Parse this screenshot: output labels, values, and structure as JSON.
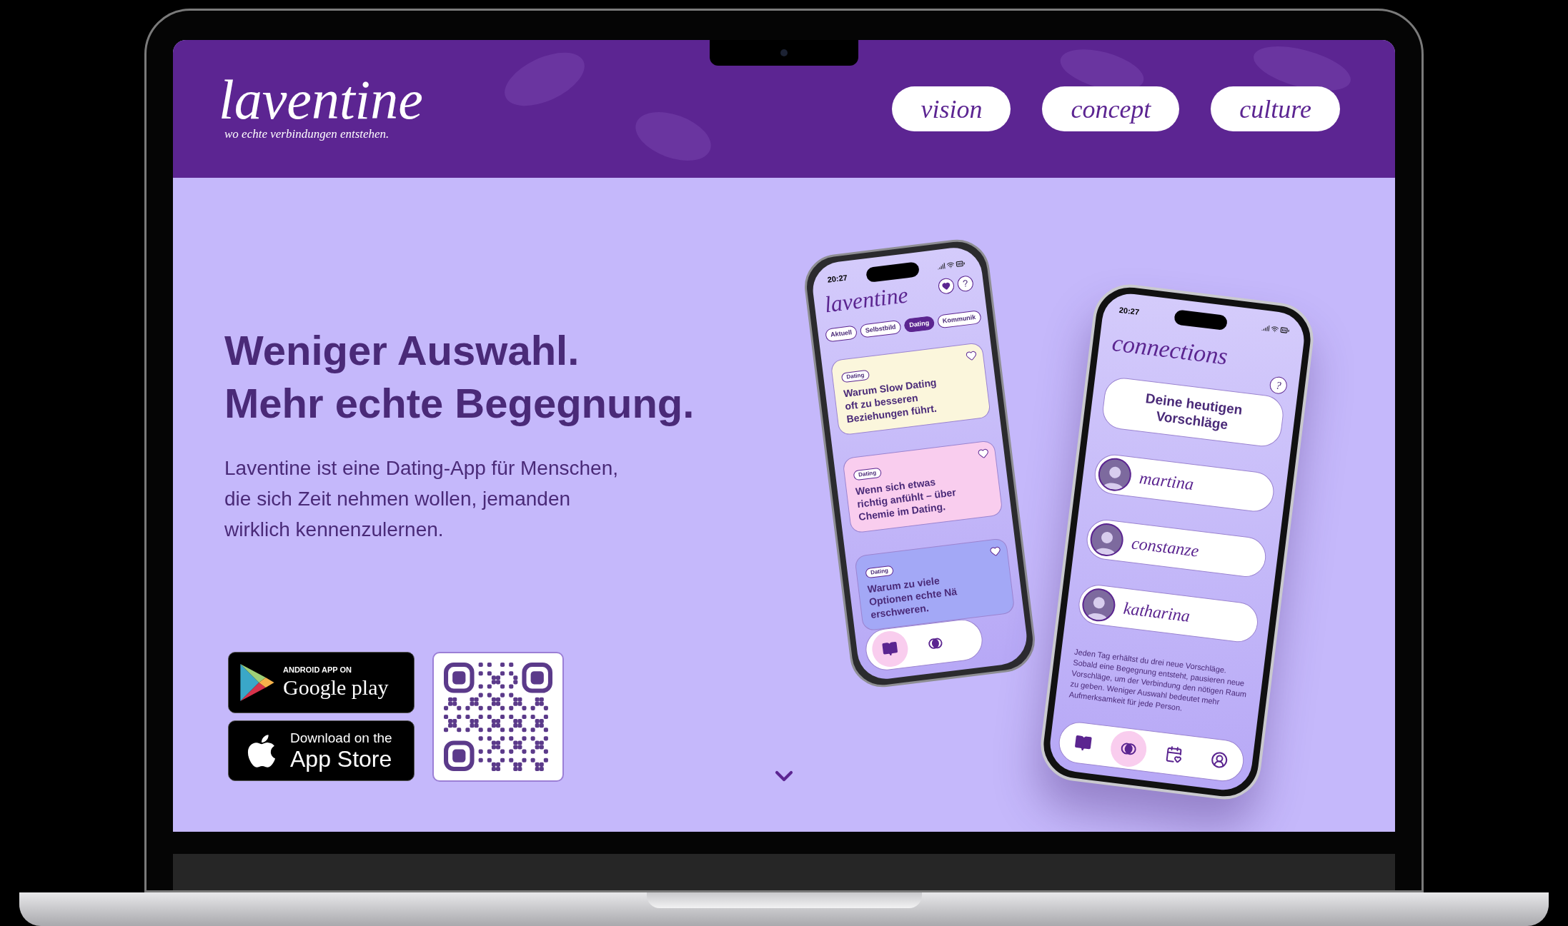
{
  "header": {
    "logo": "laventine",
    "tagline": "wo echte verbindungen entstehen.",
    "nav": [
      {
        "label": "vision"
      },
      {
        "label": "concept"
      },
      {
        "label": "culture"
      }
    ]
  },
  "hero": {
    "headline": "Weniger Auswahl.\nMehr echte Begegnung.",
    "description": "Laventine ist eine Dating-App für Menschen, die sich Zeit nehmen wollen, jemanden wirklich kennenzulernen.",
    "store_badges": [
      {
        "kind": "google_play",
        "small_text": "ANDROID APP ON",
        "large_text": "Google play"
      },
      {
        "kind": "app_store",
        "small_text": "Download on the",
        "large_text": "App Store"
      }
    ]
  },
  "phones": [
    {
      "kind": "feed",
      "time": "20:27",
      "logo": "laventine",
      "help": "?",
      "tabs": [
        {
          "label": "Aktuell",
          "selected": false
        },
        {
          "label": "Selbstbild",
          "selected": false
        },
        {
          "label": "Dating",
          "selected": true
        },
        {
          "label": "Kommunik",
          "selected": false
        }
      ],
      "cards": [
        {
          "tag": "Dating",
          "title": "Warum Slow Dating\noft zu besseren\nBeziehungen führt.",
          "color": "#fbf6dc"
        },
        {
          "tag": "Dating",
          "title": "Wenn sich etwas\nrichtig anfühlt – über\nChemie im Dating.",
          "color": "#f9cdee"
        },
        {
          "tag": "Dating",
          "title": "Warum zu viele\nOptionen echte Nä\nerschweren.",
          "color": "#a3a8f6"
        }
      ],
      "nav": [
        {
          "selected": true
        },
        {
          "selected": false
        }
      ]
    },
    {
      "kind": "connections",
      "time": "20:27",
      "title": "connections",
      "help": "?",
      "suggestions_title": "Deine heutigen Vorschläge",
      "people": [
        {
          "name": "martina"
        },
        {
          "name": "constanze"
        },
        {
          "name": "katharina"
        }
      ],
      "note": "Jeden Tag erhältst du drei neue Vorschläge. Sobald eine Begegnung entsteht, pausieren neue Vorschläge, um der Verbindung den nötigen Raum zu geben. Weniger Auswahl bedeutet mehr Aufmerksamkeit für jede Person.",
      "nav": [
        {
          "selected": false
        },
        {
          "selected": true
        },
        {
          "selected": false
        },
        {
          "selected": false
        }
      ]
    }
  ]
}
